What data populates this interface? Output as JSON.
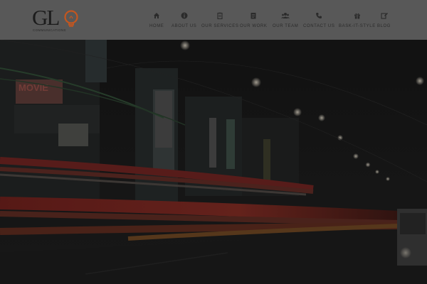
{
  "logo": {
    "letters": "GL",
    "subtitle": "COMMUNICATIONS",
    "icon": "lightbulb-icon"
  },
  "nav": [
    {
      "label": "HOME",
      "icon": "home-icon"
    },
    {
      "label": "ABOUT US",
      "icon": "info-icon"
    },
    {
      "label": "OUR SERVICES",
      "icon": "clipboard-icon"
    },
    {
      "label": "OUR WORK",
      "icon": "document-icon"
    },
    {
      "label": "OUR TEAM",
      "icon": "users-icon"
    },
    {
      "label": "CONTACT US",
      "icon": "phone-icon"
    },
    {
      "label": "BASK-IT-STYLE",
      "icon": "gift-icon"
    },
    {
      "label": "BLOG",
      "icon": "edit-icon"
    }
  ],
  "hero": {
    "sign_text": "MOVIE",
    "description_icon": "night-street-photo"
  },
  "colors": {
    "header_bg": "#585858",
    "accent": "#c4561f",
    "overlay": "#1a1a1a"
  }
}
